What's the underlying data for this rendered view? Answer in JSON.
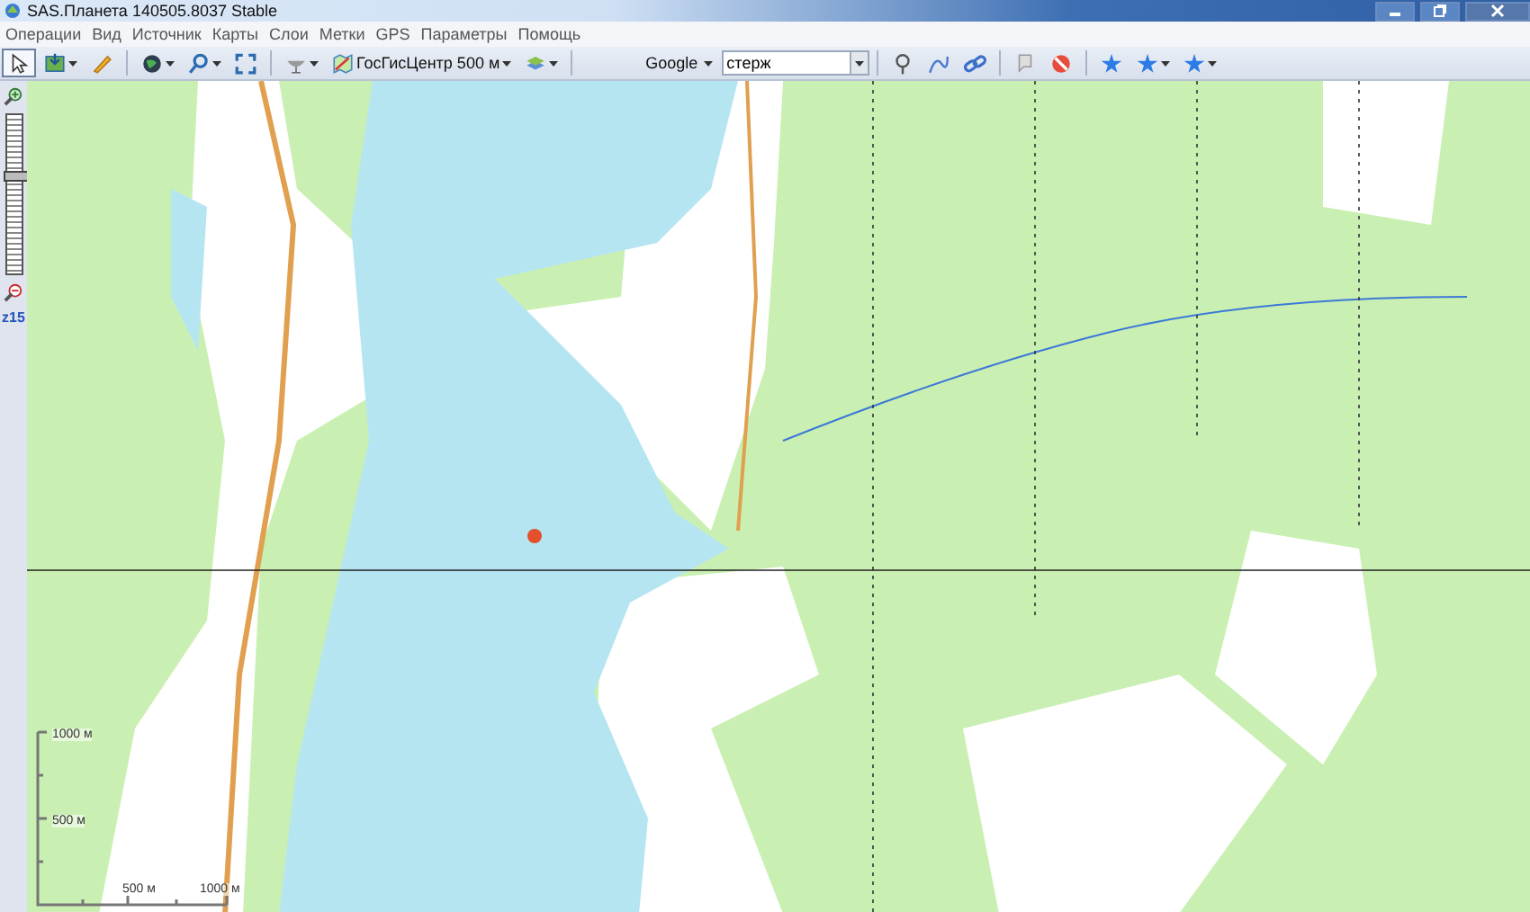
{
  "window": {
    "title": "SAS.Планета 140505.8037 Stable"
  },
  "menu": [
    "Операции",
    "Вид",
    "Источник",
    "Карты",
    "Слои",
    "Метки",
    "GPS",
    "Параметры",
    "Помощь"
  ],
  "toolbar": {
    "left_groups": [
      [
        {
          "selected": true,
          "dropdown": false
        },
        {
          "selected": false,
          "dropdown": true
        },
        {
          "selected": false,
          "dropdown": false
        }
      ],
      [
        {
          "selected": false,
          "dropdown": true
        },
        {
          "selected": false,
          "dropdown": true
        },
        {
          "selected": false,
          "dropdown": false
        }
      ],
      [
        {
          "selected": false,
          "dropdown": true
        },
        {
          "selected": false,
          "dropdown": true,
          "label": "ГосГисЦентр 500 м"
        },
        {
          "selected": false,
          "dropdown": true
        }
      ]
    ],
    "search": {
      "provider": "Google",
      "value": "стерж"
    },
    "right_groups": [
      [
        {
          "selected": false,
          "dropdown": false
        },
        {
          "selected": false,
          "dropdown": false
        },
        {
          "selected": false,
          "dropdown": false
        }
      ],
      [
        {
          "selected": false,
          "dropdown": false
        },
        {
          "selected": false,
          "dropdown": false
        }
      ],
      [
        {
          "selected": false,
          "dropdown": false
        },
        {
          "selected": false,
          "dropdown": true
        },
        {
          "selected": false,
          "dropdown": true
        }
      ]
    ]
  },
  "zoom": {
    "level": 0.6,
    "label": "z15"
  },
  "scale_bar": {
    "vertical": [
      "1000 м",
      "500 м"
    ],
    "horizontal": [
      "500 м",
      "1000 м"
    ]
  }
}
